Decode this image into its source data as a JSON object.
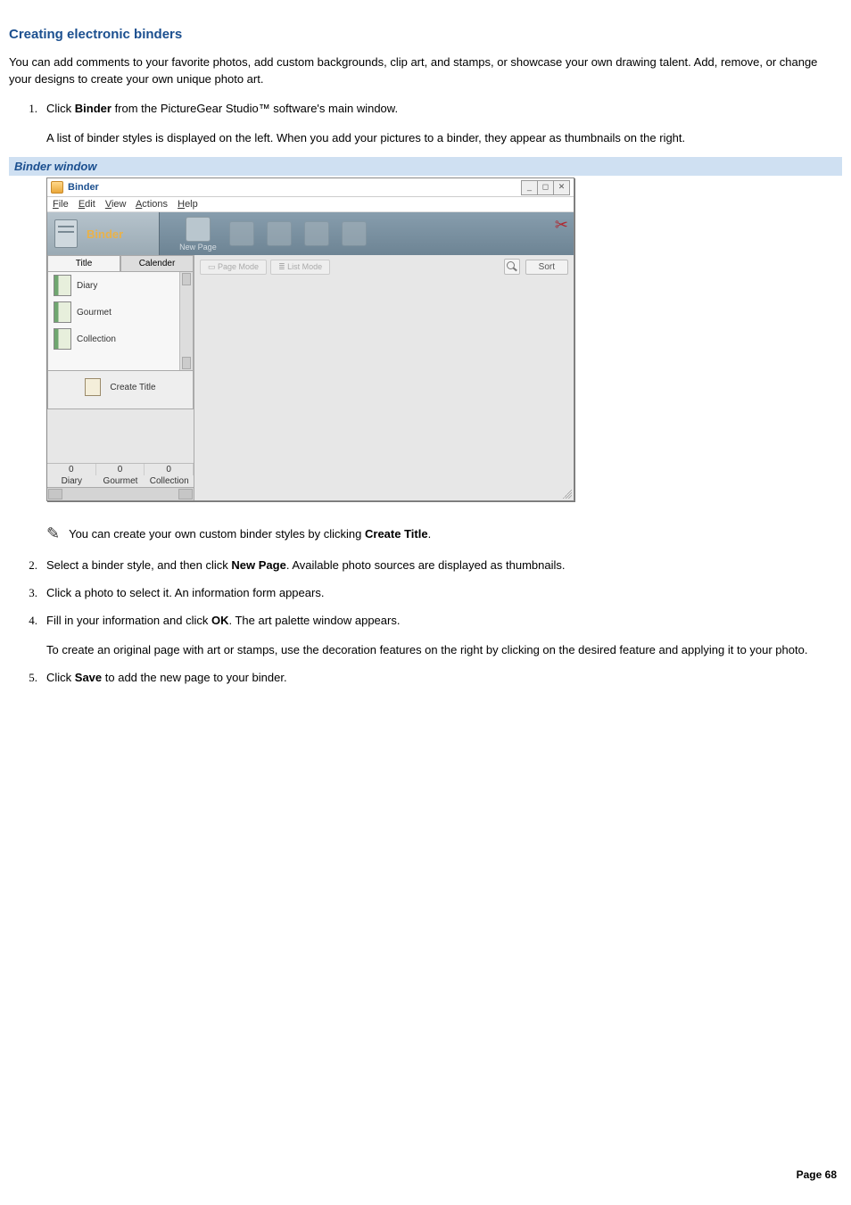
{
  "heading": "Creating electronic binders",
  "intro": "You can add comments to your favorite photos, add custom backgrounds, clip art, and stamps, or showcase your own drawing talent. Add, remove, or change your designs to create your own unique photo art.",
  "steps": {
    "s1": {
      "num": "1.",
      "a": "Click ",
      "bold": "Binder",
      "b": " from the PictureGear Studio™ software's main window.",
      "sub": "A list of binder styles is displayed on the left. When you add your pictures to a binder, they appear as thumbnails on the right."
    },
    "s2": {
      "num": "2.",
      "a": "Select a binder style, and then click ",
      "bold": "New Page",
      "b": ". Available photo sources are displayed as thumbnails."
    },
    "s3": {
      "num": "3.",
      "text": "Click a photo to select it. An information form appears."
    },
    "s4": {
      "num": "4.",
      "a": "Fill in your information and click ",
      "bold": "OK",
      "b": ". The art palette window appears.",
      "sub": "To create an original page with art or stamps, use the decoration features on the right by clicking on the desired feature and applying it to your photo."
    },
    "s5": {
      "num": "5.",
      "a": "Click ",
      "bold": "Save",
      "b": " to add the new page to your binder."
    }
  },
  "caption": "Binder window",
  "window": {
    "title": "Binder",
    "menu": {
      "file": "File",
      "edit": "Edit",
      "view": "View",
      "actions": "Actions",
      "help": "Help"
    },
    "toolbar_label": "Binder",
    "newpage": "New Page",
    "tabs": {
      "title": "Title",
      "calendar": "Calender"
    },
    "styles": {
      "diary": "Diary",
      "gourmet": "Gourmet",
      "collection": "Collection"
    },
    "create_title": "Create Title",
    "counts": {
      "c1": "0",
      "c2": "0",
      "c3": "0"
    },
    "names": {
      "n1": "Diary",
      "n2": "Gourmet",
      "n3": "Collection"
    },
    "mode": {
      "page": "Page Mode",
      "list": "List Mode"
    },
    "sort": "Sort"
  },
  "note": {
    "a": "You can create your own custom binder styles by clicking ",
    "bold": "Create Title",
    "b": "."
  },
  "footer": "Page 68"
}
